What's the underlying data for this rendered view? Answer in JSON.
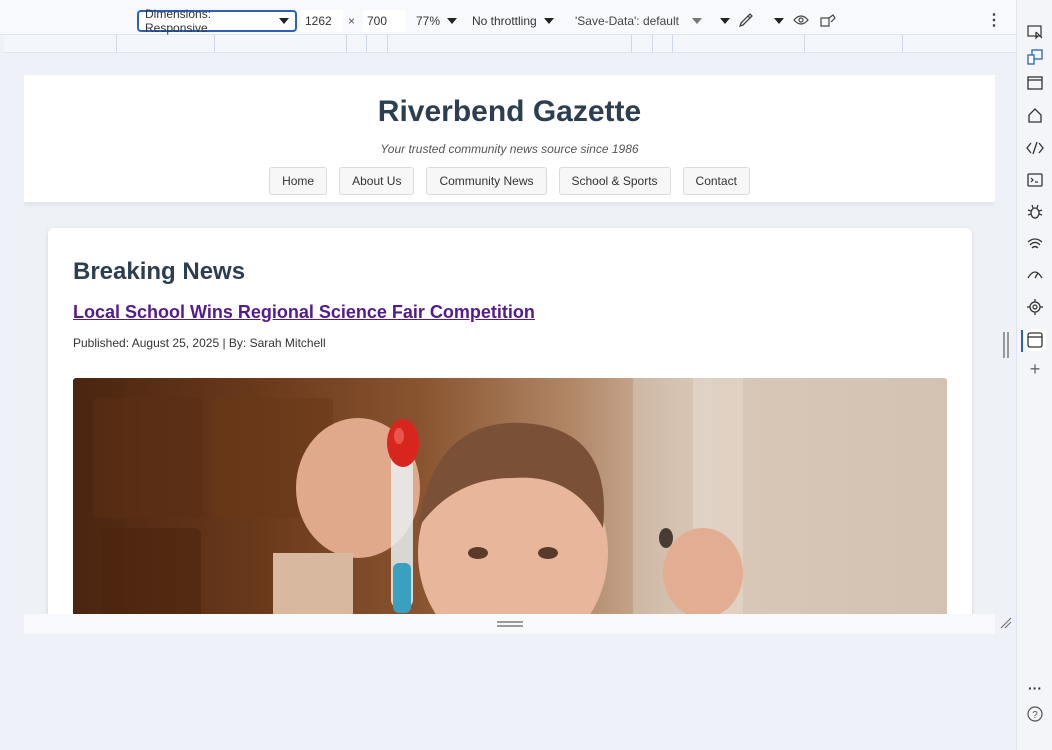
{
  "devtools": {
    "dimensions_label": "Dimensions: Responsive",
    "width_value": "1262",
    "times": "×",
    "height_value": "700",
    "zoom": "77%",
    "throttling": "No throttling",
    "save_data": "'Save-Data': default"
  },
  "site": {
    "title": "Riverbend Gazette",
    "tagline": "Your trusted community news source since 1986",
    "nav": [
      "Home",
      "About Us",
      "Community News",
      "School & Sports",
      "Contact"
    ]
  },
  "article": {
    "section": "Breaking News",
    "headline": "Local School Wins Regional Science Fair Competition",
    "byline": "Published: August 25, 2025 | By: Sarah Mitchell",
    "image_alt": "child holding a pipette with blue liquid"
  },
  "icons": {
    "toolbar": [
      "eyedropper-icon",
      "eye-icon",
      "device-posture-icon",
      "more-options-icon"
    ],
    "activity_bar": [
      "inspect-icon",
      "device-emulation-icon",
      "browser-window-icon",
      "home-icon",
      "elements-icon",
      "console-icon",
      "bug-icon",
      "network-icon",
      "performance-icon",
      "settings-gear-icon",
      "app-window-icon",
      "add-tool-icon",
      "more-tools-icon",
      "help-icon"
    ]
  }
}
